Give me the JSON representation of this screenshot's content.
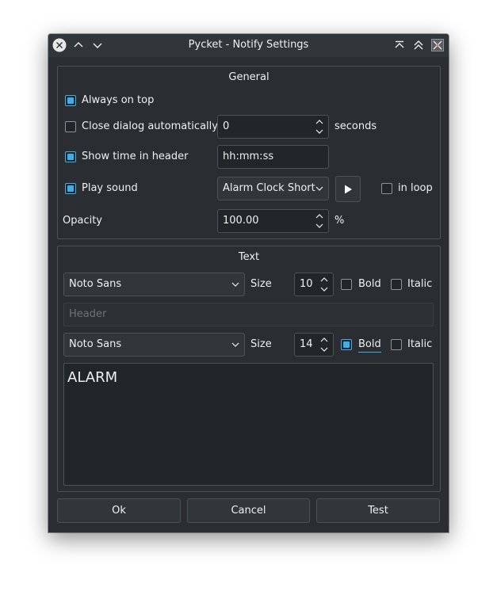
{
  "window": {
    "title": "Pycket - Notify Settings"
  },
  "general": {
    "title": "General",
    "always_on_top": {
      "label": "Always on top",
      "checked": true
    },
    "close_auto": {
      "label": "Close dialog automatically",
      "checked": false,
      "value": "0",
      "unit": "seconds"
    },
    "show_time": {
      "label": "Show time in header",
      "checked": true,
      "format": "hh:mm:ss"
    },
    "play_sound": {
      "label": "Play sound",
      "checked": true,
      "sound": "Alarm Clock Short",
      "in_loop_label": "in loop",
      "in_loop_checked": false
    },
    "opacity": {
      "label": "Opacity",
      "value": "100.00",
      "unit": "%"
    }
  },
  "text": {
    "title": "Text",
    "header_font": {
      "family": "Noto Sans",
      "size_label": "Size",
      "size": "10",
      "bold_label": "Bold",
      "bold": false,
      "italic_label": "Italic",
      "italic": false
    },
    "header_input": {
      "placeholder": "Header"
    },
    "body_font": {
      "family": "Noto Sans",
      "size_label": "Size",
      "size": "14",
      "bold_label": "Bold",
      "bold": true,
      "italic_label": "Italic",
      "italic": false
    },
    "body_text": "ALARM"
  },
  "buttons": {
    "ok": "Ok",
    "cancel": "Cancel",
    "test": "Test"
  },
  "colors": {
    "accent": "#3daee9",
    "background": "#2a2e32",
    "close_button": "#e8e8e8"
  }
}
